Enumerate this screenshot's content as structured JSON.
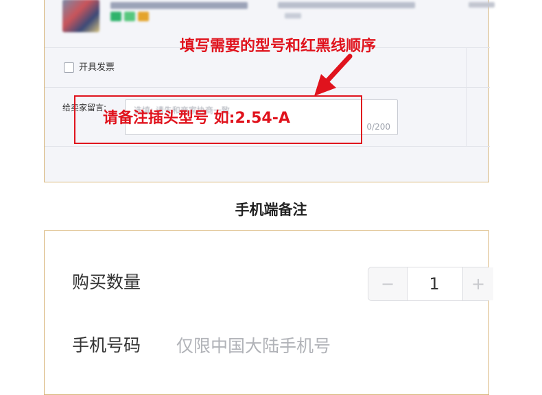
{
  "annotations": {
    "instruction": "填写需要的型号和红黑线顺序",
    "note": "请备注插头型号   如:2.54-A"
  },
  "desktop": {
    "invoice_label": "开具发票",
    "seller_message_label": "给卖家留言:",
    "message_placeholder": "选填: 请先和商家协商一致",
    "message_counter": "0/200"
  },
  "section_title": "手机端备注",
  "mobile": {
    "quantity_label": "购买数量",
    "quantity_minus": "−",
    "quantity_value": "1",
    "quantity_plus": "+",
    "phone_label": "手机号码",
    "phone_placeholder": "仅限中国大陆手机号"
  },
  "colors": {
    "annotation_red": "#e0131d",
    "panel_border": "#d9b77c"
  }
}
